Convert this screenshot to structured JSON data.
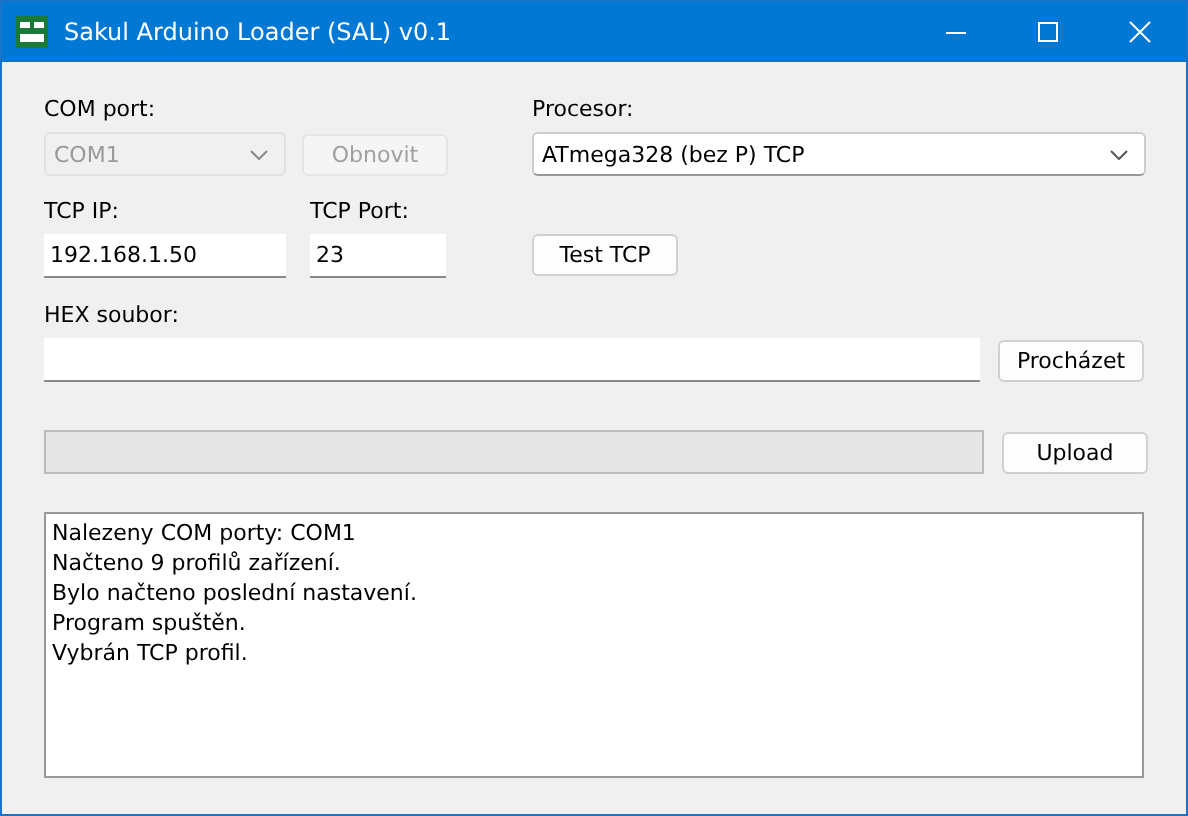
{
  "window": {
    "title": "Sakul Arduino Loader (SAL) v0.1"
  },
  "com_port": {
    "label": "COM port:",
    "value": "COM1",
    "disabled": true
  },
  "refresh_button": {
    "label": "Obnovit",
    "disabled": true
  },
  "processor": {
    "label": "Procesor:",
    "value": "ATmega328 (bez P) TCP"
  },
  "tcp_ip": {
    "label": "TCP IP:",
    "value": "192.168.1.50"
  },
  "tcp_port": {
    "label": "TCP Port:",
    "value": "23"
  },
  "test_button": {
    "label": "Test TCP"
  },
  "hex_file": {
    "label": "HEX soubor:"
  },
  "browse_button": {
    "label": "Procházet"
  },
  "progress": {
    "level": 0
  },
  "upload_button": {
    "label": "Upload"
  },
  "log": [
    "Nalezeny COM porty: COM1",
    "Načteno 9 profilů zařízení.",
    "Bylo načteno poslední nastavení.",
    "Program spuštěn.",
    "Vybrán TCP profil."
  ]
}
